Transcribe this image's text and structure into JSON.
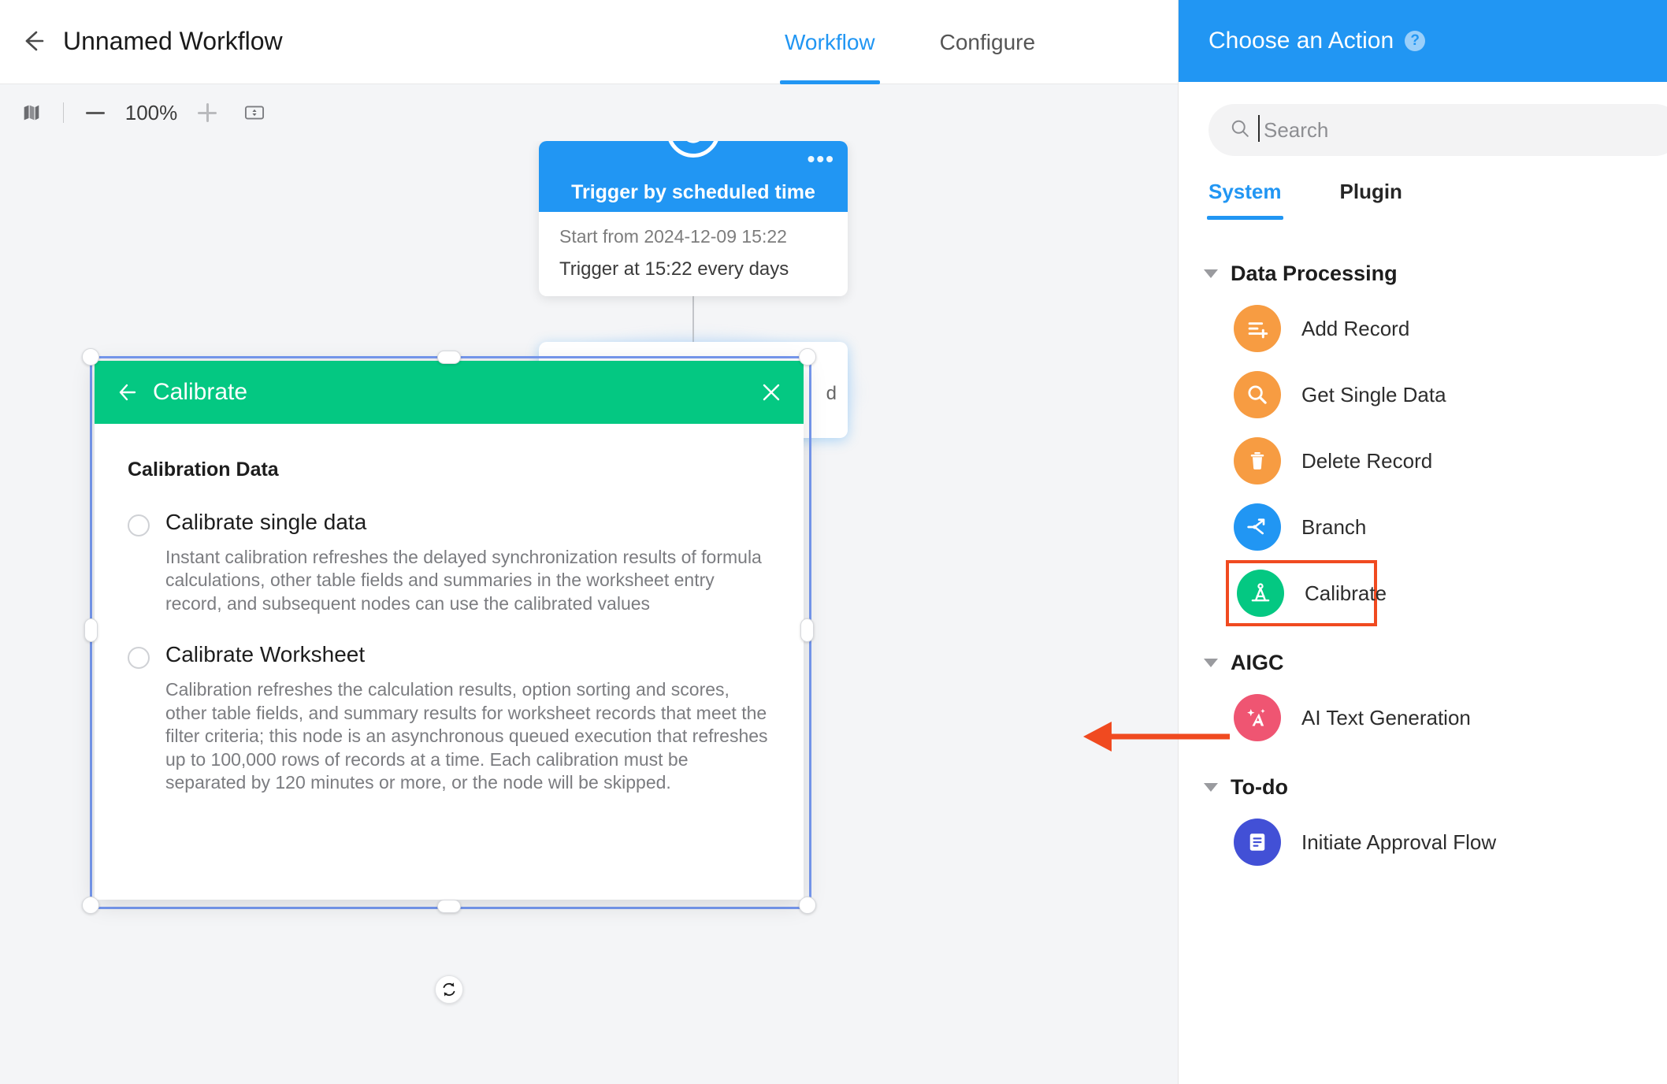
{
  "topbar": {
    "back_icon": "arrow-left-icon",
    "workflow_title": "Unnamed Workflow",
    "tabs": [
      {
        "label": "Workflow",
        "active": true
      },
      {
        "label": "Configure",
        "active": false
      }
    ]
  },
  "zoom_toolbar": {
    "map_icon": "map-icon",
    "zoom_out_icon": "minus-icon",
    "zoom_level": "100%",
    "zoom_in_icon": "plus-icon",
    "fit_icon": "fit-to-screen-icon"
  },
  "canvas": {
    "trigger_node": {
      "badge_icon": "alarm-clock-icon",
      "menu_icon": "more-horizontal-icon",
      "title": "Trigger by scheduled time",
      "start_from": "Start from 2024-12-09 15:22",
      "trigger_at": "Trigger at 15:22 every days"
    },
    "ghost_node": {
      "partial_text": "d"
    },
    "refresh_icon": "refresh-icon"
  },
  "dialog": {
    "back_icon": "arrow-left-icon",
    "title": "Calibrate",
    "close_icon": "close-icon",
    "section_title": "Calibration Data",
    "options": [
      {
        "label": "Calibrate single data",
        "selected": false,
        "description": "Instant calibration refreshes the delayed synchronization results of formula calculations, other table fields and summaries in the worksheet entry record, and subsequent nodes can use the calibrated values"
      },
      {
        "label": "Calibrate Worksheet",
        "selected": false,
        "description": "Calibration refreshes the calculation results, option sorting and scores, other table fields, and summary results for worksheet records that meet the filter criteria; this node is an asynchronous queued execution that refreshes up to 100,000 rows of records at a time. Each calibration must be separated by 120 minutes or more, or the node will be skipped."
      }
    ]
  },
  "panel": {
    "header_title": "Choose an Action",
    "help_icon": "help-circle-icon",
    "search": {
      "icon": "search-icon",
      "placeholder": "Search",
      "value": ""
    },
    "sub_tabs": [
      {
        "label": "System",
        "active": true
      },
      {
        "label": "Plugin",
        "active": false
      }
    ],
    "groups": [
      {
        "title": "Data Processing",
        "expanded": true,
        "actions": [
          {
            "label": "Add Record",
            "icon": "add-record-icon",
            "color": "#f79c42",
            "highlighted": false
          },
          {
            "label": "Get Single Data",
            "icon": "search-icon",
            "color": "#f79c42",
            "highlighted": false
          },
          {
            "label": "Delete Record",
            "icon": "trash-icon",
            "color": "#f79c42",
            "highlighted": false
          },
          {
            "label": "Branch",
            "icon": "branch-icon",
            "color": "#2196f3",
            "highlighted": false
          },
          {
            "label": "Calibrate",
            "icon": "compass-icon",
            "color": "#04c882",
            "highlighted": true
          }
        ]
      },
      {
        "title": "AIGC",
        "expanded": true,
        "actions": [
          {
            "label": "AI Text Generation",
            "icon": "ai-text-icon",
            "color": "#ef5572",
            "highlighted": false
          }
        ]
      },
      {
        "title": "To-do",
        "expanded": true,
        "actions": [
          {
            "label": "Initiate Approval Flow",
            "icon": "approval-icon",
            "color": "#4250d6",
            "highlighted": false
          }
        ]
      }
    ]
  },
  "annotation": {
    "arrow_color": "#f04a20",
    "highlight_color": "#f04a20"
  },
  "colors": {
    "brand_blue": "#2196f3",
    "brand_green": "#04c882",
    "canvas_bg": "#f4f5f7",
    "selection_blue": "#7799f0"
  }
}
